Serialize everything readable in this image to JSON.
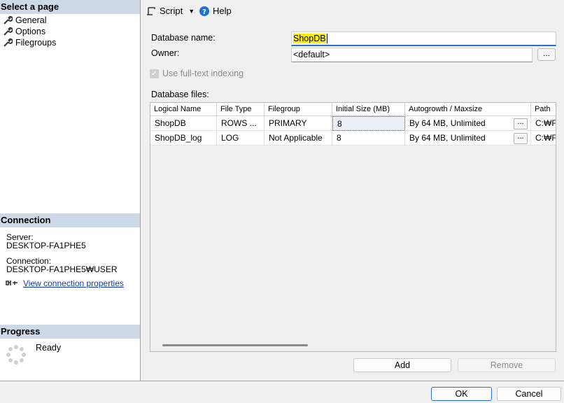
{
  "left": {
    "select_page_header": "Select a page",
    "pages": [
      {
        "label": "General",
        "icon": "wrench-icon"
      },
      {
        "label": "Options",
        "icon": "wrench-icon"
      },
      {
        "label": "Filegroups",
        "icon": "wrench-icon"
      }
    ],
    "connection_header": "Connection",
    "server_label": "Server:",
    "server_value": "DESKTOP-FA1PHE5",
    "connection_label": "Connection:",
    "connection_value": "DESKTOP-FA1PHE5₩USER",
    "view_connection_link": "View connection properties",
    "progress_header": "Progress",
    "progress_status": "Ready"
  },
  "toolbar": {
    "script_label": "Script",
    "help_label": "Help"
  },
  "form": {
    "db_name_label": "Database name:",
    "db_name_value": "ShopDB",
    "owner_label": "Owner:",
    "owner_value": "<default>",
    "browse_label": "...",
    "fulltext_label": "Use full-text indexing",
    "db_files_label": "Database files:"
  },
  "grid": {
    "columns": [
      "Logical Name",
      "File Type",
      "Filegroup",
      "Initial Size (MB)",
      "Autogrowth / Maxsize",
      "Path"
    ],
    "rows": [
      {
        "logical_name": "ShopDB",
        "file_type": "ROWS ...",
        "filegroup": "PRIMARY",
        "initial_size": "8",
        "autogrowth": "By 64 MB, Unlimited",
        "btn": "...",
        "path": "C:₩F"
      },
      {
        "logical_name": "ShopDB_log",
        "file_type": "LOG",
        "filegroup": "Not Applicable",
        "initial_size": "8",
        "autogrowth": "By 64 MB, Unlimited",
        "btn": "...",
        "path": "C:₩F"
      }
    ]
  },
  "buttons": {
    "add": "Add",
    "remove": "Remove",
    "ok": "OK",
    "cancel": "Cancel"
  },
  "colors": {
    "section_header": "#cdd9e6",
    "highlight": "#ffef00",
    "link": "#0b3aa8"
  }
}
